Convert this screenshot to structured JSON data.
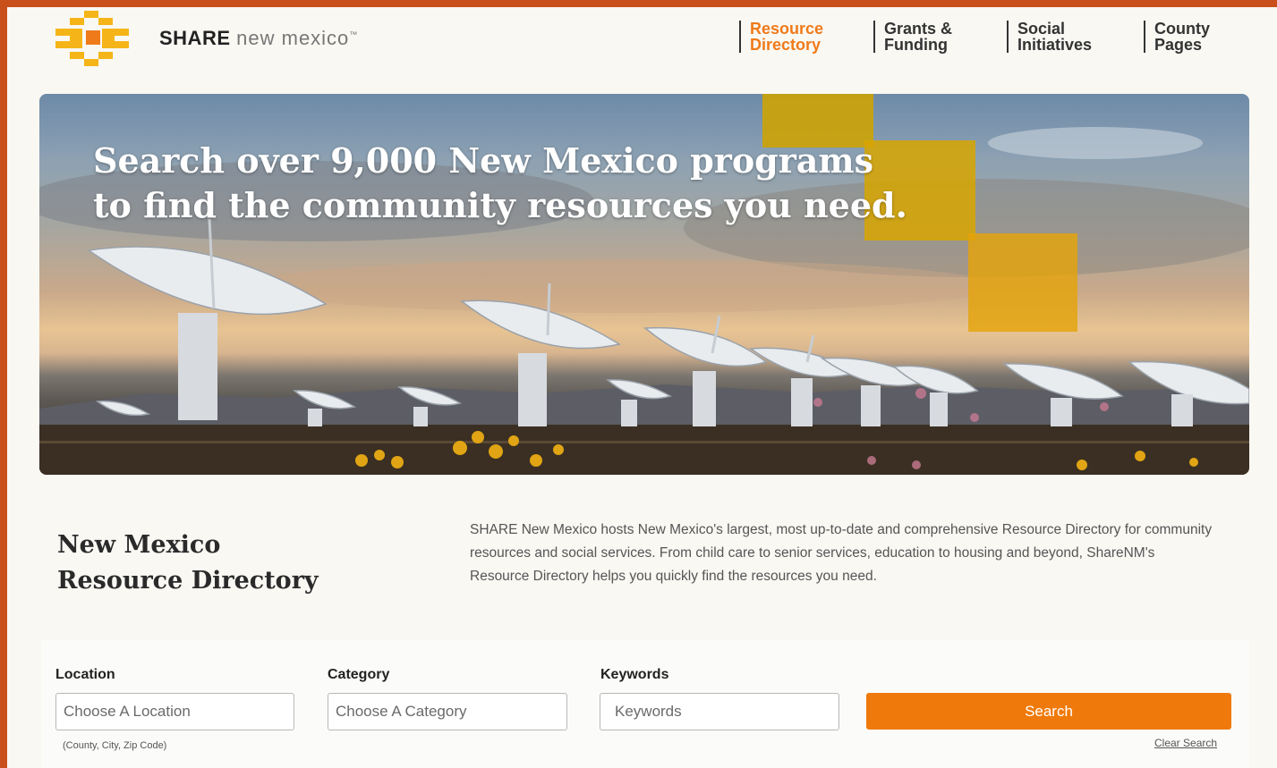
{
  "header": {
    "logo": {
      "brand": "SHARE",
      "rest": "new mexico",
      "tm": "™"
    },
    "nav": [
      {
        "line1": "Resource",
        "line2": "Directory",
        "active": true
      },
      {
        "line1": "Grants &",
        "line2": "Funding",
        "active": false
      },
      {
        "line1": "Social",
        "line2": "Initiatives",
        "active": false
      },
      {
        "line1": "County",
        "line2": "Pages",
        "active": false
      }
    ]
  },
  "hero": {
    "line1": "Search over 9,000 New Mexico programs",
    "line2": "to find the community resources you need."
  },
  "intro": {
    "title_line1": "New Mexico",
    "title_line2": "Resource Directory",
    "text": "SHARE New Mexico hosts New Mexico's largest, most up-to-date and comprehensive Resource Directory for community resources and social services. From child care to senior services, education to housing and beyond, ShareNM's Resource Directory helps you quickly find the resources you need."
  },
  "search": {
    "location_label": "Location",
    "location_placeholder": "Choose A Location",
    "location_hint": "(County, City, Zip Code)",
    "category_label": "Category",
    "category_placeholder": "Choose A Category",
    "keywords_label": "Keywords",
    "keywords_placeholder": "Keywords",
    "search_button": "Search",
    "clear_link": "Clear Search"
  },
  "colors": {
    "accent": "#ef7a0b",
    "frame": "#c9501b",
    "logo_gold": "#f5b518",
    "logo_orange": "#ef7a1a"
  }
}
